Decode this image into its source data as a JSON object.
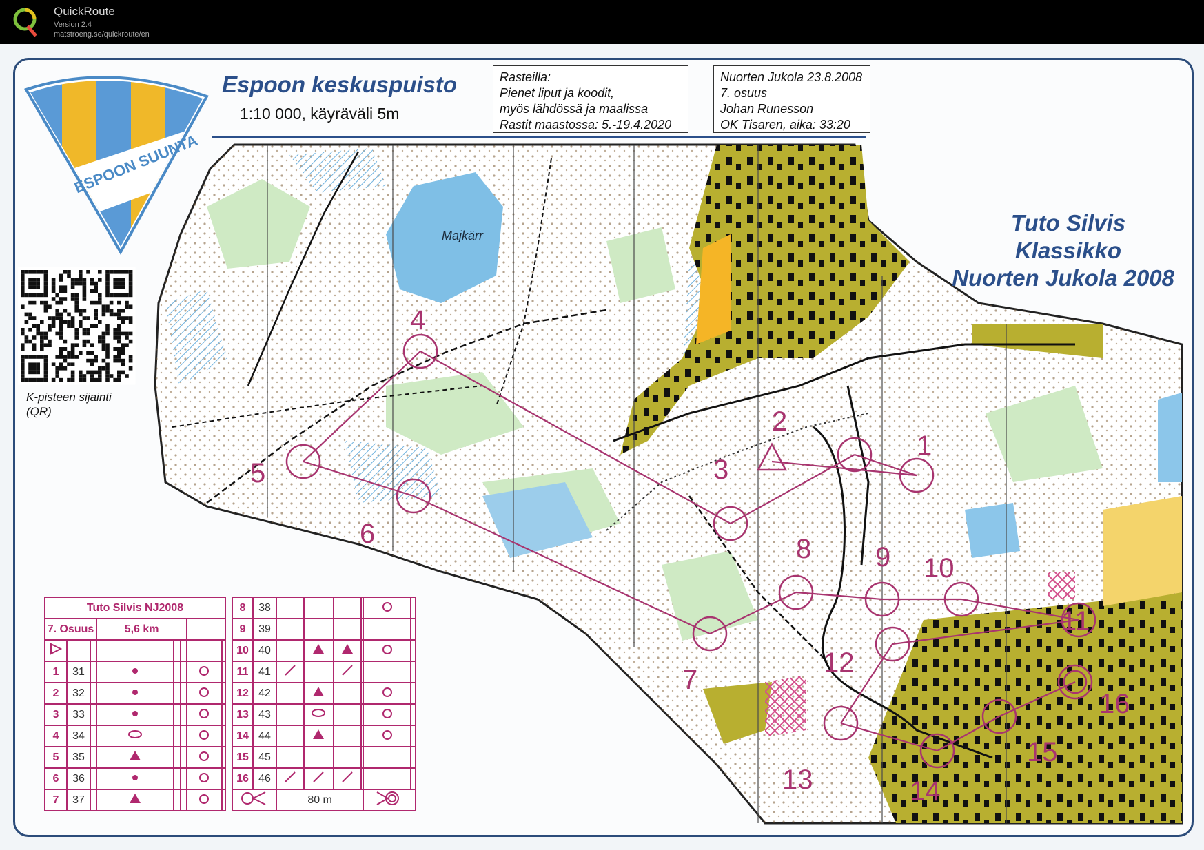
{
  "app": {
    "name": "QuickRoute",
    "version": "Version 2.4",
    "url": "matstroeng.se/quickroute/en"
  },
  "map": {
    "title": "Espoon keskuspuisto",
    "scale": "1:10 000, käyräväli 5m",
    "club_logo_text": "ESPOON SUUNTA",
    "lake_label": "Majkärr",
    "qr_caption_1": "K-pisteen sijainti",
    "qr_caption_2": "(QR)",
    "info_left": [
      "Rasteilla:",
      "Pienet liput ja koodit,",
      "myös lähdössä ja maalissa",
      "Rastit maastossa: 5.-19.4.2020"
    ],
    "info_right": [
      "Nuorten Jukola 23.8.2008",
      "7. osuus",
      "Johan Runesson",
      "OK Tisaren, aika: 33:20"
    ],
    "event_title": [
      "Tuto Silvis",
      "Klassikko",
      "Nuorten Jukola 2008"
    ],
    "colors": {
      "course": "#a8346f",
      "title_blue": "#2b4f8a",
      "urban_olive": "#b5ad2e",
      "water": "#76b8e0",
      "green": "#c3e6b8"
    }
  },
  "controls": [
    {
      "label": "1"
    },
    {
      "label": "2"
    },
    {
      "label": "3"
    },
    {
      "label": "4"
    },
    {
      "label": "5"
    },
    {
      "label": "6"
    },
    {
      "label": "7"
    },
    {
      "label": "8"
    },
    {
      "label": "9"
    },
    {
      "label": "10"
    },
    {
      "label": "11"
    },
    {
      "label": "12"
    },
    {
      "label": "13"
    },
    {
      "label": "14"
    },
    {
      "label": "15"
    },
    {
      "label": "16"
    }
  ],
  "description": {
    "title": "Tuto Silvis NJ2008",
    "leg": "7. Osuus",
    "length": "5,6 km",
    "finish_distance": "80 m",
    "rows_left": [
      {
        "n": "1",
        "code": "31"
      },
      {
        "n": "2",
        "code": "32"
      },
      {
        "n": "3",
        "code": "33"
      },
      {
        "n": "4",
        "code": "34"
      },
      {
        "n": "5",
        "code": "35"
      },
      {
        "n": "6",
        "code": "36"
      },
      {
        "n": "7",
        "code": "37"
      }
    ],
    "rows_right": [
      {
        "n": "8",
        "code": "38"
      },
      {
        "n": "9",
        "code": "39"
      },
      {
        "n": "10",
        "code": "40"
      },
      {
        "n": "11",
        "code": "41"
      },
      {
        "n": "12",
        "code": "42"
      },
      {
        "n": "13",
        "code": "43"
      },
      {
        "n": "14",
        "code": "44"
      },
      {
        "n": "15",
        "code": "45"
      },
      {
        "n": "16",
        "code": "46"
      }
    ]
  }
}
